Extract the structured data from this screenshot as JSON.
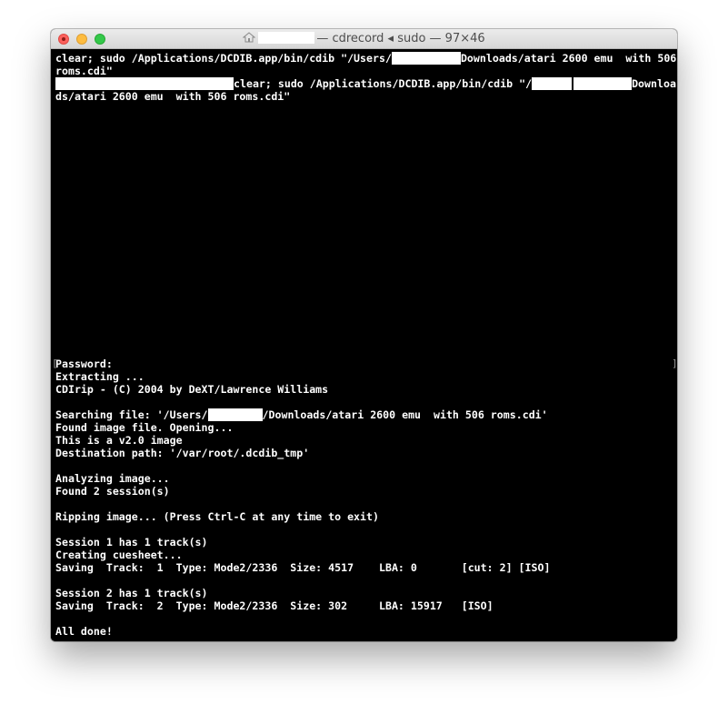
{
  "window": {
    "title_prefix": "— cdrecord ◂ sudo — 97×46"
  },
  "terminal": {
    "lines": [
      {
        "segments": [
          "clear; sudo /Applications/DCDIB.app/bin/cdib \"/Users/",
          "Downloads/atari 2600 emu  with 506"
        ]
      },
      {
        "segments": [
          "roms.cdi\""
        ]
      },
      {
        "segments": [
          "clear; sudo /Applications/DCDIB.app/bin/cdib \"/",
          "Downloa"
        ]
      },
      {
        "segments": [
          "ds/atari 2600 emu  with 506 roms.cdi\""
        ]
      },
      {
        "segments": [
          "Password:"
        ]
      },
      {
        "segments": [
          "Extracting ..."
        ]
      },
      {
        "segments": [
          "CDIrip - (C) 2004 by DeXT/Lawrence Williams"
        ]
      },
      {
        "segments": [
          "Searching file: '/Users/",
          "/Downloads/atari 2600 emu  with 506 roms.cdi'"
        ]
      },
      {
        "segments": [
          "Found image file. Opening..."
        ]
      },
      {
        "segments": [
          "This is a v2.0 image"
        ]
      },
      {
        "segments": [
          "Destination path: '/var/root/.dcdib_tmp'"
        ]
      },
      {
        "segments": [
          "Analyzing image..."
        ]
      },
      {
        "segments": [
          "Found 2 session(s)"
        ]
      },
      {
        "segments": [
          "Ripping image... (Press Ctrl-C at any time to exit)"
        ]
      },
      {
        "segments": [
          "Session 1 has 1 track(s)"
        ]
      },
      {
        "segments": [
          "Creating cuesheet..."
        ]
      },
      {
        "segments": [
          "Saving  Track:  1  Type: Mode2/2336  Size: 4517    LBA: 0       [cut: 2] [ISO]"
        ]
      },
      {
        "segments": [
          "Session 2 has 1 track(s)"
        ]
      },
      {
        "segments": [
          "Saving  Track:  2  Type: Mode2/2336  Size: 302     LBA: 15917   [ISO]"
        ]
      },
      {
        "segments": [
          "All done!"
        ]
      }
    ]
  },
  "colors": {
    "terminal_bg": "#000000",
    "terminal_fg": "#ffffff",
    "close": "#fc605c",
    "minimize": "#fdbc40",
    "zoom": "#34c84a"
  },
  "icons": [
    "close-button",
    "minimize-button",
    "zoom-button",
    "home-icon"
  ]
}
